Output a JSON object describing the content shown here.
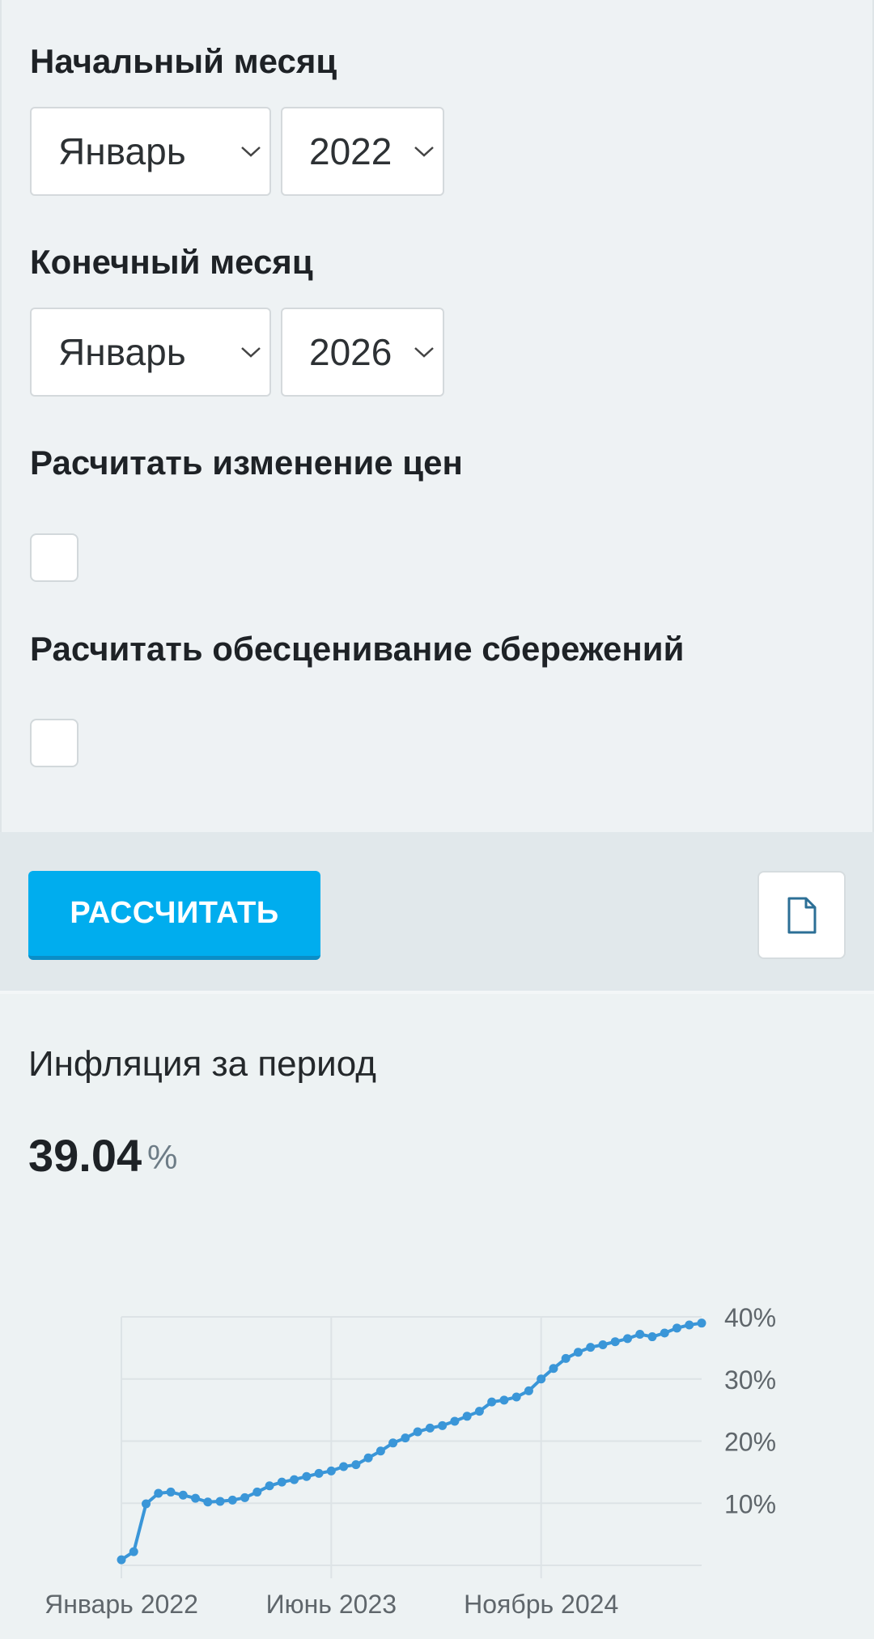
{
  "form": {
    "start_label": "Начальный месяц",
    "start_month": "Январь",
    "start_year": "2022",
    "end_label": "Конечный месяц",
    "end_month": "Январь",
    "end_year": "2026",
    "prices_label": "Расчитать изменение цен",
    "prices_checked": false,
    "savings_label": "Расчитать обесценивание сбережений",
    "savings_checked": false
  },
  "actions": {
    "calculate_label": "РАССЧИТАТЬ",
    "document_icon": "document-icon"
  },
  "result": {
    "title": "Инфляция за период",
    "value": "39.04",
    "unit": "%"
  },
  "chart_data": {
    "type": "line",
    "grid": true,
    "ylim": [
      0,
      40
    ],
    "y_ticks": [
      10,
      20,
      30,
      40
    ],
    "y_tick_labels": [
      "10%",
      "20%",
      "30%",
      "40%"
    ],
    "x_tick_labels": [
      "Январь 2022",
      "Июнь 2023",
      "Ноябрь 2024"
    ],
    "x_tick_indices": [
      0,
      17,
      34
    ],
    "line_color": "#3a96d8",
    "grid_color": "#dde3e6",
    "series": [
      {
        "values": [
          0.9,
          2.2,
          9.9,
          11.6,
          11.8,
          11.3,
          10.8,
          10.2,
          10.3,
          10.5,
          10.9,
          11.8,
          12.8,
          13.4,
          13.8,
          14.3,
          14.8,
          15.2,
          15.9,
          16.2,
          17.3,
          18.4,
          19.7,
          20.5,
          21.5,
          22.1,
          22.5,
          23.2,
          24.0,
          24.8,
          26.3,
          26.6,
          27.1,
          28.1,
          30.0,
          31.7,
          33.3,
          34.3,
          35.1,
          35.5,
          36.0,
          36.5,
          37.2,
          36.8,
          37.4,
          38.2,
          38.7,
          39.0
        ]
      }
    ]
  }
}
